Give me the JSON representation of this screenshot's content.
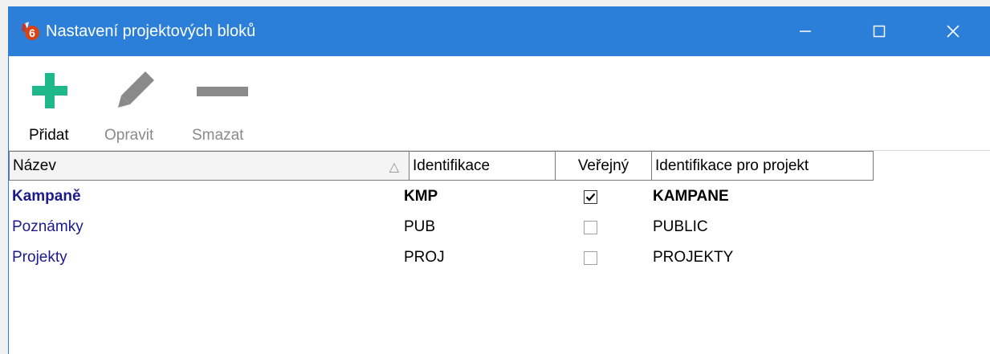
{
  "window": {
    "title": "Nastavení projektových bloků",
    "title_color": "#2b7fd8"
  },
  "toolbar": {
    "add_label": "Přidat",
    "edit_label": "Opravit",
    "delete_label": "Smazat",
    "add_color": "#1fb88a",
    "disabled_color": "#8a8a8a"
  },
  "table": {
    "columns": [
      "Název",
      "Identifikace",
      "Veřejný",
      "Identifikace pro projekt"
    ],
    "sort_indicator": "△",
    "rows": [
      {
        "name": "Kampaně",
        "ident": "KMP",
        "public": true,
        "project_ident": "KAMPANE",
        "bold": true
      },
      {
        "name": "Poznámky",
        "ident": "PUB",
        "public": false,
        "project_ident": "PUBLIC",
        "bold": false
      },
      {
        "name": "Projekty",
        "ident": "PROJ",
        "public": false,
        "project_ident": "PROJEKTY",
        "bold": false
      }
    ]
  }
}
